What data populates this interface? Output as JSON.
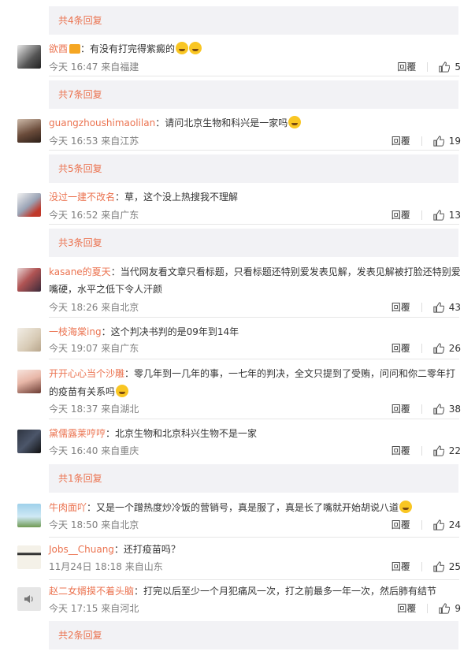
{
  "like_icon": "thumbs-up-icon",
  "reply_label": "回覆",
  "colors": {
    "username": "#eb7350",
    "more_bar_bg": "#f2f2f5",
    "more_text": "#eb7350",
    "meta": "#808080"
  },
  "more": [
    "共4条回复",
    "共7条回复",
    "共5条回复",
    "共3条回复",
    "共1条回复",
    "共2条回复"
  ],
  "comments": [
    {
      "user": "欲酉",
      "text": "：有没有打完得紫癜的",
      "time": "今天 16:47 来自福建",
      "likes": "5"
    },
    {
      "user": "guangzhoushimaolilan",
      "text": "：请问北京生物和科兴是一家吗",
      "time": "今天 16:53 来自江苏",
      "likes": "19"
    },
    {
      "user": "没过一建不改名",
      "text": "：草，这个没上热搜我不理解",
      "time": "今天 16:52 来自广东",
      "likes": "13"
    },
    {
      "user": "kasane的夏天",
      "text": "：当代网友看文章只看标题，只看标题还特别爱发表见解，发表见解被打脸还特别爱",
      "text2": "嘴硬，水平之低下令人汗颜",
      "time": "今天 18:26 来自北京",
      "likes": "43"
    },
    {
      "user": "一枝海棠ing",
      "text": "：这个判决书判的是09年到14年",
      "time": "今天 19:07 来自广东",
      "likes": "26"
    },
    {
      "user": "开开心心当个沙雕",
      "text": "：零几年到一几年的事，一七年的判决，全文只提到了受贿，问问和你二零年打",
      "text2": "的疫苗有关系吗",
      "time": "今天 18:37 来自湖北",
      "likes": "38"
    },
    {
      "user": "黛儒露莱哼哼",
      "text": "：北京生物和北京科兴生物不是一家",
      "time": "今天 16:40 来自重庆",
      "likes": "22"
    },
    {
      "user": "牛肉面吖",
      "text": "：又是一个蹭热度炒冷饭的营销号，真是服了，真是长了嘴就开始胡说八道",
      "time": "今天 18:50 来自北京",
      "likes": "24"
    },
    {
      "user": "Jobs__Chuang",
      "text": "：还打疫苗吗？",
      "time": "11月24日 18:18 来自山东",
      "likes": "25"
    },
    {
      "user": "赵二女婿摸不着头脑",
      "text": "：打完以后至少一个月犯痛风一次，打之前最多一年一次，然后肺有结节",
      "time": "今天 17:15 来自河北",
      "likes": "9"
    }
  ]
}
